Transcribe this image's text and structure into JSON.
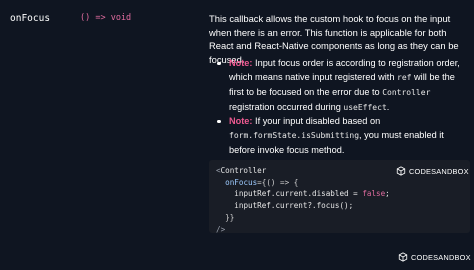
{
  "prop": {
    "name": "onFocus",
    "type": "() => void"
  },
  "description": {
    "text": "This callback allows the custom hook to focus on the input when there is an error. This function is applicable for both React and React-Native components as long as they can be focused."
  },
  "notes": [
    {
      "label": "Note:",
      "parts": [
        " Input focus order is according to registration order, which means native input registered with ",
        "ref",
        " will be the first to be focused on the error due to ",
        "Controller",
        " registration occurred during ",
        "useEffect",
        "."
      ]
    },
    {
      "label": "Note:",
      "parts": [
        " If your input disabled based on ",
        "form.formState.isSubmitting",
        ", you must enabled it before invoke focus method."
      ]
    }
  ],
  "code": {
    "line1_open": "<",
    "line1_comp": "Controller",
    "line2_attr": "onFocus",
    "line2_rest": "={() => {",
    "line3_a": "inputRef.current.disabled = ",
    "line3_kw": "false",
    "line3_b": ";",
    "line4": "inputRef.current?.focus();",
    "line5": "}}",
    "line6": "/>"
  },
  "codesandbox": {
    "label": "CODESANDBOX",
    "icon": "codesandbox-icon"
  }
}
